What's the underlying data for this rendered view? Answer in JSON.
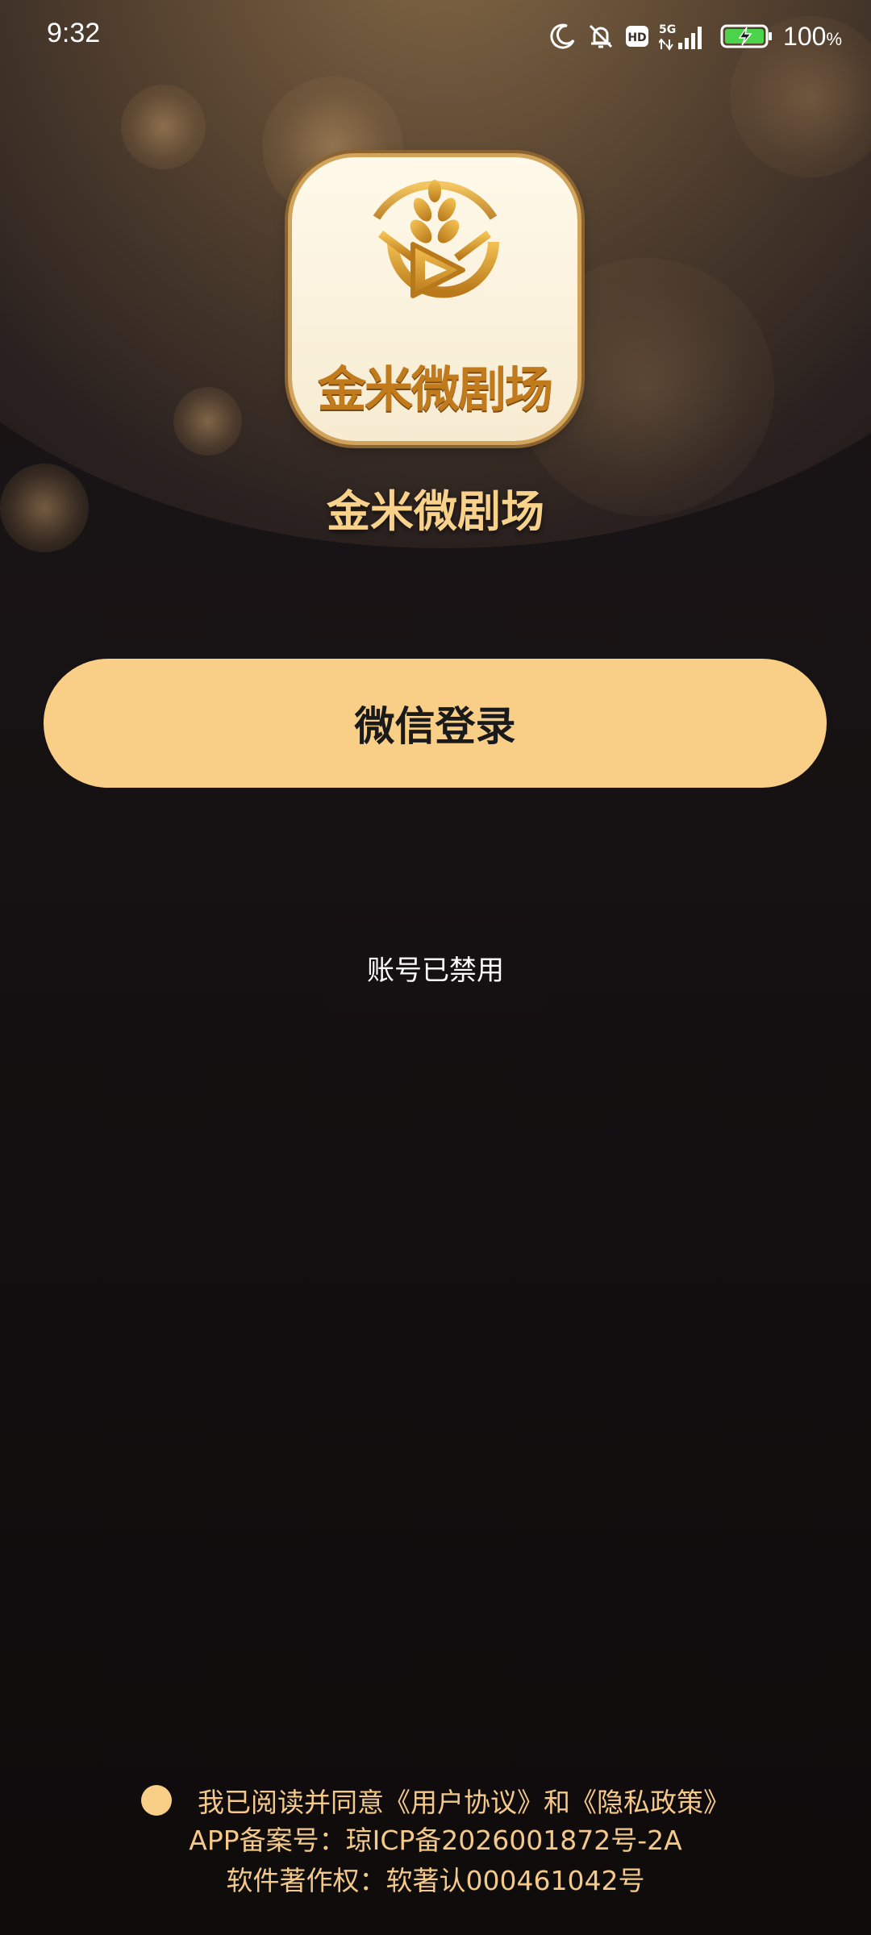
{
  "status_bar": {
    "time": "9:32",
    "battery_percent": "100",
    "battery_unit": "%",
    "network": "5G",
    "hd_label": "HD",
    "icons": [
      "moon-icon",
      "bell-off-icon",
      "hd-icon",
      "signal-icon",
      "battery-charging-icon"
    ]
  },
  "app": {
    "icon_text": "金米微剧场",
    "name": "金米微剧场"
  },
  "login": {
    "wechat_label": "微信登录"
  },
  "toast": {
    "message": "账号已禁用"
  },
  "footer": {
    "agreement": "我已阅读并同意《用户协议》和《隐私政策》",
    "app_record": "APP备案号：琼ICP备2026001872号-2A",
    "copyright": "软件著作权：软著认000461042号"
  },
  "colors": {
    "accent": "#f9cf87",
    "background": "#130f10",
    "title_gold": "#f8d18b"
  }
}
